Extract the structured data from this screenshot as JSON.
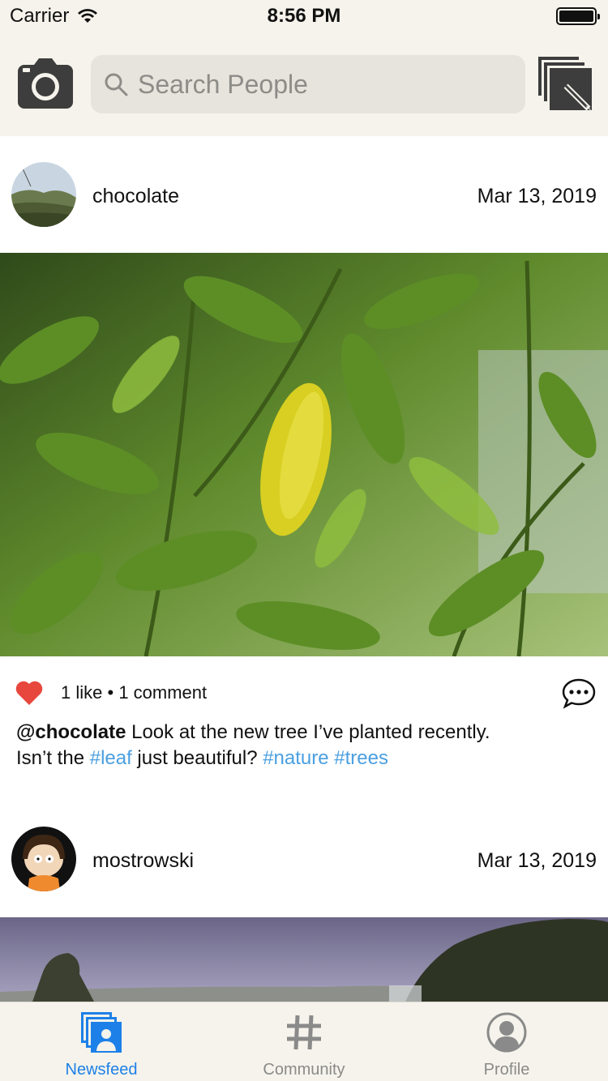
{
  "status_bar": {
    "carrier": "Carrier",
    "time": "8:56 PM"
  },
  "nav": {
    "search_placeholder": "Search People",
    "icons": [
      "camera-icon",
      "search-icon",
      "compose-icon"
    ]
  },
  "posts": [
    {
      "username": "chocolate",
      "date": "Mar 13, 2019",
      "likes_text": "1 like",
      "separator": "•",
      "comments_text": "1 comment",
      "caption": {
        "mention": "@chocolate",
        "text1": " Look at the new tree I’ve planted recently. Isn’t the ",
        "tag1": "#leaf",
        "text2": " just beautiful? ",
        "tag2": "#nature",
        "space": " ",
        "tag3": "#trees"
      }
    },
    {
      "username": "mostrowski",
      "date": "Mar 13, 2019"
    }
  ],
  "tabs": [
    {
      "label": "Newsfeed",
      "icon": "newsfeed-icon",
      "active": true
    },
    {
      "label": "Community",
      "icon": "hashtag-icon",
      "active": false
    },
    {
      "label": "Profile",
      "icon": "profile-icon",
      "active": false
    }
  ],
  "colors": {
    "accent": "#1d80e8",
    "hashtag": "#4a9fe0",
    "heart": "#e8473e",
    "bar_background": "#f5f3eb"
  }
}
